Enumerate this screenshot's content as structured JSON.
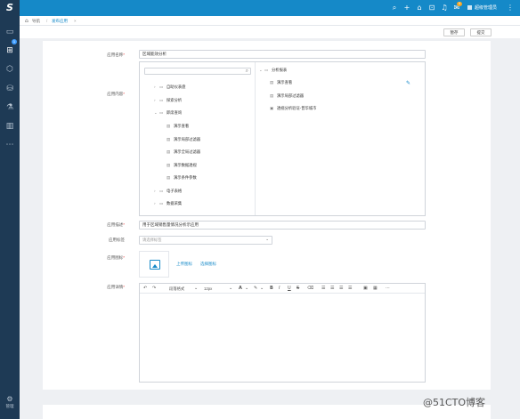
{
  "sidebar": {
    "logo": "S",
    "badge": "1",
    "items": [
      {
        "icon": "monitor-icon"
      },
      {
        "icon": "grid-apps-icon"
      },
      {
        "icon": "cube-icon"
      },
      {
        "icon": "database-icon"
      },
      {
        "icon": "flask-icon"
      },
      {
        "icon": "bar-chart-icon"
      },
      {
        "icon": "more-icon"
      }
    ],
    "footer_label": "管理"
  },
  "topbar": {
    "badge": "9",
    "user": "超级管理员"
  },
  "breadcrumb": {
    "home": "导航",
    "current": "发布应用"
  },
  "toolbar": {
    "save_label": "暂存",
    "submit_label": "提交"
  },
  "form": {
    "app_name_label": "应用名称",
    "app_name_value": "区域能效分析",
    "app_content_label": "应用内容",
    "tree_left": [
      {
        "label": "自助仪表盘",
        "type": "folder",
        "arrow": "›"
      },
      {
        "label": "探索分析",
        "type": "folder",
        "arrow": "›"
      },
      {
        "label": "即席查询",
        "type": "folder",
        "arrow": "⌄"
      },
      {
        "label": "演示查看",
        "type": "doc"
      },
      {
        "label": "演示局部过滤器",
        "type": "doc"
      },
      {
        "label": "演示全局过滤器",
        "type": "doc"
      },
      {
        "label": "演示数据透视",
        "type": "doc"
      },
      {
        "label": "演示条件参数",
        "type": "doc"
      },
      {
        "label": "电子表格",
        "type": "folder",
        "arrow": "›"
      },
      {
        "label": "数据采集",
        "type": "folder",
        "arrow": "›"
      }
    ],
    "tree_right": {
      "root": "分析报表",
      "items": [
        "演示查看",
        "演示局部过滤器",
        "透视分析验证-普华城市"
      ]
    },
    "desc_label": "应用描述",
    "desc_value": "用于区域销售量情况分析示应用",
    "tag_label": "应用标签",
    "tag_placeholder": "请选择标签",
    "icon_label": "应用图标",
    "upload_link": "上传图标",
    "choose_link": "选择图标",
    "detail_label": "应用详情",
    "editor": {
      "paragraph": "段落格式",
      "font_size": "12px"
    }
  },
  "watermark": "@51CTO博客"
}
